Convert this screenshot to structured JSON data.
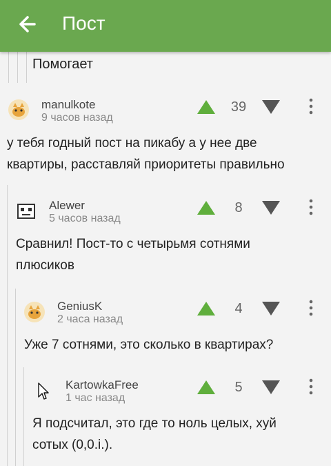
{
  "header": {
    "title": "Пост",
    "back_icon": "arrow-back-icon",
    "color": "#6aa84f"
  },
  "previous_comment": {
    "text": "Помогает"
  },
  "comments": [
    {
      "author": "manulkote",
      "time": "9 часов назад",
      "score": "39",
      "avatar": "cat-avatar",
      "text_lines": [
        "у тебя годный пост на пикабу а у нее две",
        "квартиры, расставляй приоритеты правильно"
      ]
    },
    {
      "author": "Alewer",
      "time": "5 часов назад",
      "score": "8",
      "avatar": "pixel-avatar",
      "text_lines": [
        "Сравнил! Пост-то с четырьмя сотнями",
        "плюсиков"
      ]
    },
    {
      "author": "GeniusK",
      "time": "2 часа назад",
      "score": "4",
      "avatar": "cat-avatar",
      "text_lines": [
        "Уже 7 сотнями, это сколько в квартирах?"
      ]
    },
    {
      "author": "KartowkaFree",
      "time": "1 час назад",
      "score": "5",
      "avatar": "none",
      "text_lines": [
        "Я подсчитал, это где то ноль целых, хуй",
        "сотых (0,0.i.)."
      ]
    }
  ],
  "colors": {
    "upvote": "#5fae3c",
    "downvote": "#555555",
    "thread_line": "#d0d0d0"
  }
}
